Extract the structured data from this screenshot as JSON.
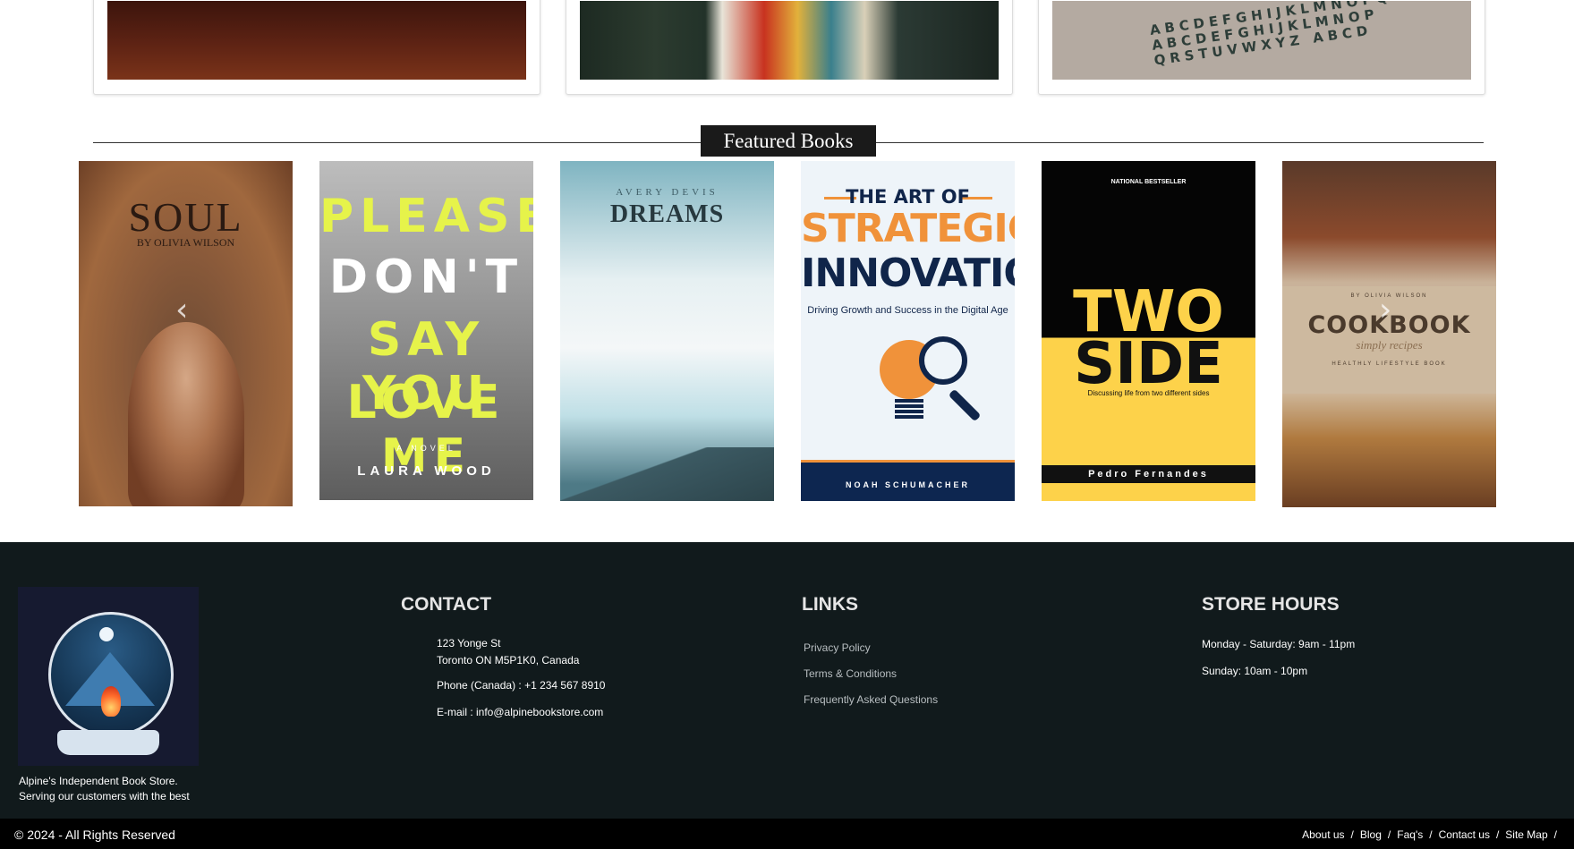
{
  "featured": {
    "title": "Featured Books"
  },
  "books": [
    {
      "title": "SOUL",
      "author": "BY OLIVIA WILSON"
    },
    {
      "lines": [
        "PLEASE",
        "DON'T",
        "SAY YOU",
        "LOVE ME"
      ],
      "tag": "A NOVEL",
      "author": "LAURA WOOD"
    },
    {
      "author": "AVERY DEVIS",
      "title": "DREAMS"
    },
    {
      "pre": "THE ART OF",
      "line1": "STRATEGIC",
      "line2": "INNOVATION",
      "subtitle": "Driving Growth and Success in the Digital Age",
      "author": "NOAH SCHUMACHER"
    },
    {
      "badge": "NATIONAL BESTSELLER",
      "line1": "TWO",
      "line2": "SIDE",
      "subtitle": "Discussing life from two different sides",
      "author": "Pedro Fernandes"
    },
    {
      "author": "BY OLIVIA WILSON",
      "title": "COOKBOOK",
      "subtitle": "simply recipes",
      "tag": "HEALTHLY LIFESTYLE BOOK"
    }
  ],
  "carousel": {
    "prev_icon": "chevron-left-icon",
    "next_icon": "chevron-right-icon",
    "glyph_prev": "‹",
    "glyph_next": "›"
  },
  "footer": {
    "tagline_1": "Alpine's Independent Book Store.",
    "tagline_2": "Serving our customers with the best",
    "contact": {
      "heading": "CONTACT",
      "address_1": "123 Yonge St",
      "address_2": "Toronto ON M5P1K0, Canada",
      "phone": "Phone (Canada) : +1 234 567 8910",
      "email": "E-mail : info@alpinebookstore.com"
    },
    "links": {
      "heading": "LINKS",
      "items": [
        "Privacy Policy",
        "Terms & Conditions",
        "Frequently Asked Questions"
      ]
    },
    "hours": {
      "heading": "STORE HOURS",
      "weekday": "Monday - Saturday: 9am - 11pm",
      "sunday": "Sunday: 10am - 10pm"
    }
  },
  "bottom": {
    "copyright": "© 2024 - All Rights Reserved",
    "links": [
      "About us",
      "Blog",
      "Faq's",
      "Contact us",
      "Site Map"
    ],
    "separator": "/"
  },
  "colors": {
    "footer_bg": "#111a1c",
    "bottom_bar": "#000000",
    "heading_bg": "#1a1a1a"
  }
}
